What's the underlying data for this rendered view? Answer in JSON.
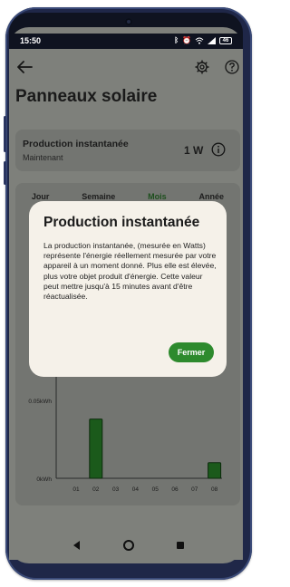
{
  "status_bar": {
    "time": "15:50",
    "icons": [
      "bluetooth-icon",
      "alarm-icon",
      "wifi-icon",
      "signal-icon"
    ],
    "battery": "46"
  },
  "header": {
    "title": "Panneaux solaire",
    "icons": [
      "back-arrow-icon",
      "gear-icon",
      "help-icon"
    ]
  },
  "production_card": {
    "title": "Production instantanée",
    "subtitle": "Maintenant",
    "value": "1 W",
    "icon": "info-icon"
  },
  "tabs": [
    {
      "label": "Jour",
      "active": false
    },
    {
      "label": "Semaine",
      "active": false
    },
    {
      "label": "Mois",
      "active": true
    },
    {
      "label": "Année",
      "active": false
    }
  ],
  "chart_data": {
    "type": "bar",
    "categories": [
      "01",
      "02",
      "03",
      "04",
      "05",
      "06",
      "07",
      "08"
    ],
    "values": [
      0,
      0.038,
      0,
      0,
      0,
      0,
      0,
      0.01
    ],
    "y_ticks": [
      "0.05kWh",
      "0kWh"
    ],
    "ylim": [
      0,
      0.05
    ],
    "bar_color": "#1b5a1b",
    "xlabel": "",
    "ylabel": ""
  },
  "dialog": {
    "title": "Production instantanée",
    "body": "La production instantanée, (mesurée en Watts) représente l'énergie réellement mesurée par votre appareil à un moment donné. Plus elle est élevée, plus votre objet produit d'énergie. Cette valeur peut mettre jusqu'à 15 minutes avant d'être réactualisée.",
    "button": "Fermer"
  },
  "colors": {
    "accent": "#2d8a2d",
    "dialog_bg": "#f5f1e9",
    "frame": "#1f2748"
  }
}
